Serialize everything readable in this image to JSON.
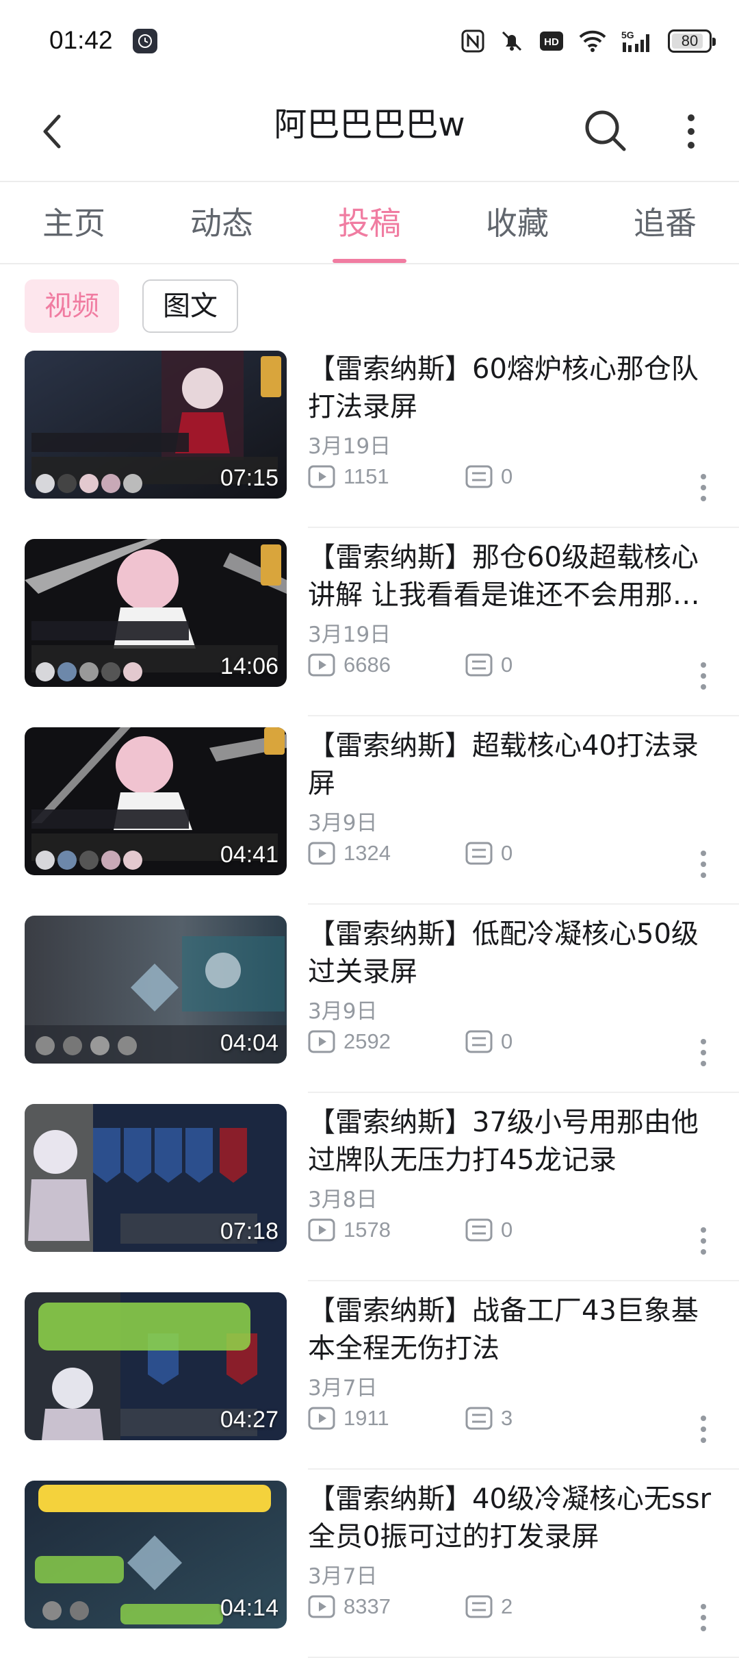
{
  "status": {
    "time": "01:42",
    "network": "5G",
    "battery": "80"
  },
  "header": {
    "title": "阿巴巴巴巴w"
  },
  "tabs": [
    {
      "label": "主页"
    },
    {
      "label": "动态"
    },
    {
      "label": "投稿"
    },
    {
      "label": "收藏"
    },
    {
      "label": "追番"
    }
  ],
  "active_tab": "投稿",
  "filters": {
    "video": "视频",
    "article": "图文"
  },
  "colors": {
    "accent": "#f07ca1",
    "chip_bg": "#fde6ed",
    "meta": "#9499a0"
  },
  "videos": [
    {
      "title": "【雷索纳斯】60熔炉核心那仓队打法录屏",
      "date": "3月19日",
      "plays": "1151",
      "comments": "0",
      "duration": "07:15"
    },
    {
      "title": "【雷索纳斯】那仓60级超载核心讲解 让我看看是谁还不会用那…",
      "date": "3月19日",
      "plays": "6686",
      "comments": "0",
      "duration": "14:06"
    },
    {
      "title": "【雷索纳斯】超载核心40打法录屏",
      "date": "3月9日",
      "plays": "1324",
      "comments": "0",
      "duration": "04:41"
    },
    {
      "title": "【雷索纳斯】低配冷凝核心50级过关录屏",
      "date": "3月9日",
      "plays": "2592",
      "comments": "0",
      "duration": "04:04"
    },
    {
      "title": "【雷索纳斯】37级小号用那由他过牌队无压力打45龙记录",
      "date": "3月8日",
      "plays": "1578",
      "comments": "0",
      "duration": "07:18"
    },
    {
      "title": "【雷索纳斯】战备工厂43巨象基本全程无伤打法",
      "date": "3月7日",
      "plays": "1911",
      "comments": "3",
      "duration": "04:27"
    },
    {
      "title": "【雷索纳斯】40级冷凝核心无ssr全员0振可过的打发录屏",
      "date": "3月7日",
      "plays": "8337",
      "comments": "2",
      "duration": "04:14"
    }
  ]
}
